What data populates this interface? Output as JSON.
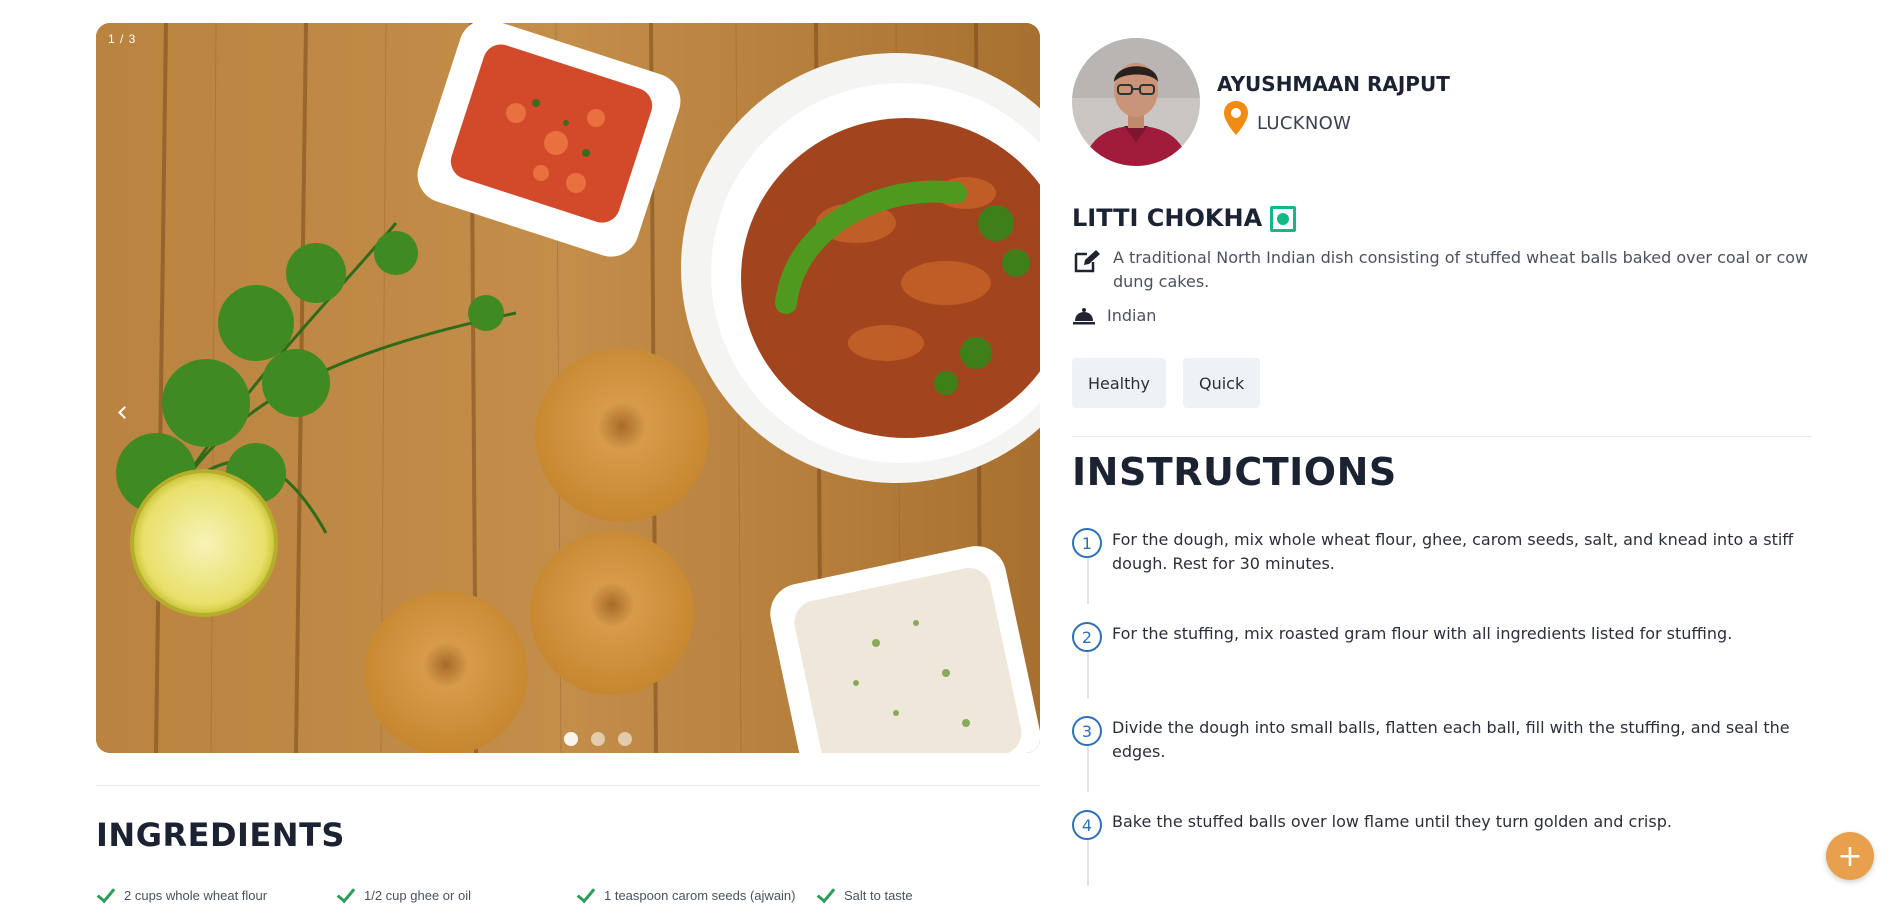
{
  "gallery": {
    "counter": "1 / 3",
    "prev_icon": "chevron-left-icon",
    "next_icon": "chevron-right-icon",
    "slide_count": 3,
    "active_slide": 1
  },
  "author": {
    "name": "AYUSHMAAN RAJPUT",
    "location": "LUCKNOW",
    "location_icon": "map-pin-icon"
  },
  "recipe": {
    "title": "LITTI CHOKHA",
    "veg_indicator": "veg-icon",
    "description": "A traditional North Indian dish consisting of stuffed wheat balls baked over coal or cow dung cakes.",
    "cuisine": "Indian",
    "tags": [
      "Healthy",
      "Quick"
    ]
  },
  "ingredients": {
    "title": "INGREDIENTS",
    "items": [
      "2 cups whole wheat flour",
      "1/2 cup ghee or oil",
      "1 teaspoon carom seeds (ajwain)",
      "Salt to taste"
    ]
  },
  "instructions": {
    "title": "INSTRUCTIONS",
    "steps": [
      {
        "number": "1",
        "text": "For the dough, mix whole wheat flour, ghee, carom seeds, salt, and knead into a stiff dough. Rest for 30 minutes."
      },
      {
        "number": "2",
        "text": "For the stuffing, mix roasted gram flour with all ingredients listed for stuffing."
      },
      {
        "number": "3",
        "text": "Divide the dough into small balls, flatten each ball, fill with the stuffing, and seal the edges."
      },
      {
        "number": "4",
        "text": "Bake the stuffed balls over low flame until they turn golden and crisp."
      }
    ]
  },
  "fab": {
    "label": "+",
    "icon": "plus-icon"
  },
  "colors": {
    "accent": "#e9a04c",
    "veg_green": "#12b886",
    "step_blue": "#2f6fb5",
    "check_green": "#2e9e5b",
    "pin_orange": "#f08c14"
  }
}
